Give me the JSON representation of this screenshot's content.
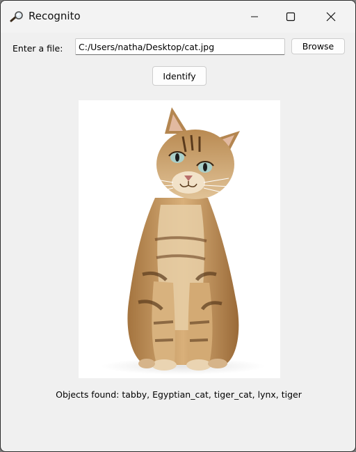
{
  "window": {
    "title": "Recognito"
  },
  "form": {
    "file_label": "Enter a file:",
    "file_path": "C:/Users/natha/Desktop/cat.jpg",
    "browse_label": "Browse",
    "identify_label": "Identify"
  },
  "result": {
    "text": "Objects found: tabby, Egyptian_cat, tiger_cat, lynx, tiger"
  },
  "icons": {
    "app": "magnifier-icon",
    "minimize": "minimize-icon",
    "maximize": "maximize-icon",
    "close": "close-icon"
  }
}
